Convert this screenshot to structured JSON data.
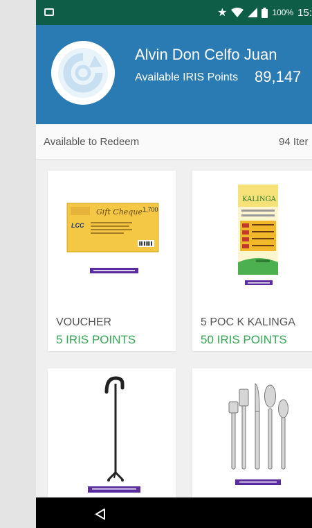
{
  "status_bar": {
    "battery": "100%",
    "time": "15:",
    "icons": [
      "image-icon",
      "star-icon",
      "wifi-icon",
      "signal-icon",
      "battery-icon"
    ]
  },
  "profile": {
    "name": "Alvin Don Celfo Juan",
    "points_label": "Available IRIS Points",
    "points_value": "89,147",
    "avatar_icon": "refresh-logo-icon"
  },
  "redeem_bar": {
    "label": "Available to Redeem",
    "count": "94 Iter"
  },
  "items": [
    {
      "title": "VOUCHER",
      "points": "5 IRIS POINTS",
      "voucher_text": "Gift Cheque",
      "voucher_amount": "1,700",
      "voucher_brand": "LCC"
    },
    {
      "title": "5 POC K KALINGA",
      "points": "50 IRIS POINTS",
      "brand_text": "KALINGA"
    },
    {
      "title": "",
      "points": ""
    },
    {
      "title": "",
      "points": ""
    }
  ],
  "colors": {
    "status_bar": "#0e5e47",
    "header": "#2a7ab3",
    "points_green": "#34a853",
    "label_purple": "#5a2ca0"
  },
  "nav": {
    "back_icon": "back-triangle-icon"
  }
}
